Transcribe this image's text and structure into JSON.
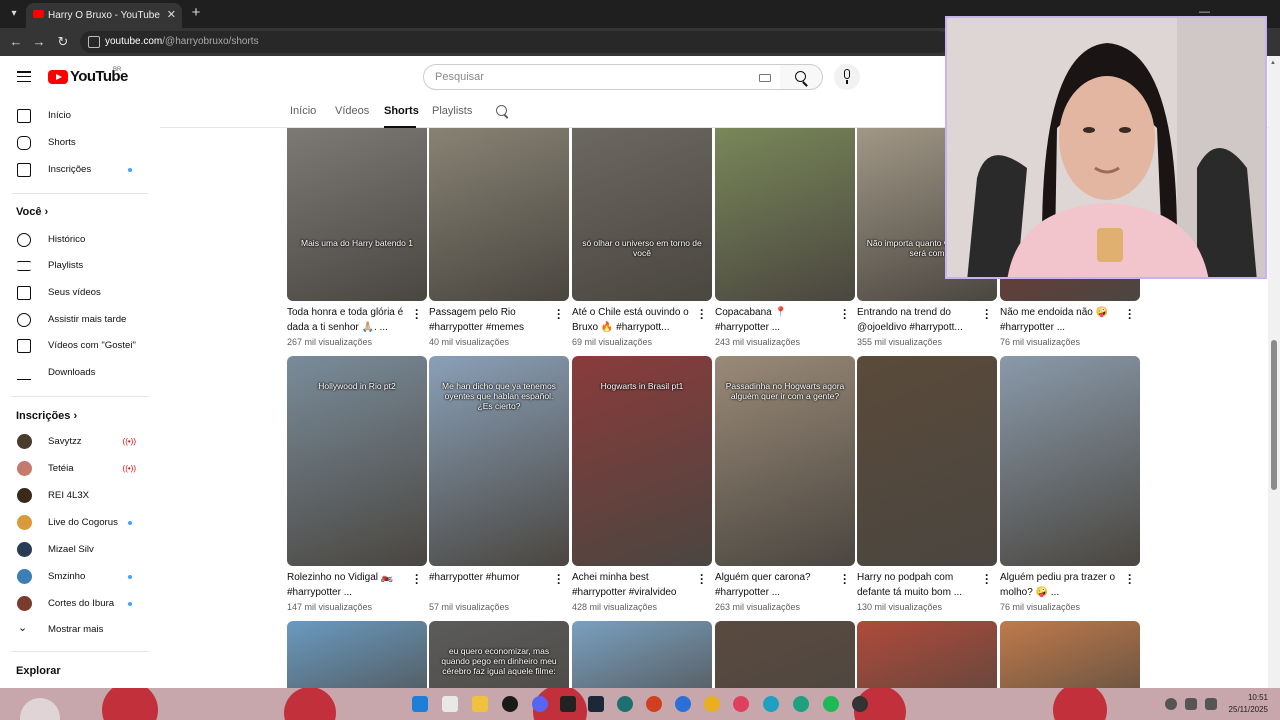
{
  "browser": {
    "tab_title": "Harry O Bruxo - YouTube",
    "url_host": "youtube.com",
    "url_path": "/@harryobruxo/shorts"
  },
  "masthead": {
    "logo_text": "YouTube",
    "country_code": "BR",
    "search_placeholder": "Pesquisar"
  },
  "sidebar": {
    "main": [
      {
        "label": "Início",
        "icon": "home-icon"
      },
      {
        "label": "Shorts",
        "icon": "shorts-icon"
      },
      {
        "label": "Inscrições",
        "icon": "subscriptions-icon",
        "dot": true
      }
    ],
    "you_heading": "Você",
    "you": [
      {
        "label": "Histórico",
        "icon": "history-icon"
      },
      {
        "label": "Playlists",
        "icon": "playlists-icon"
      },
      {
        "label": "Seus vídeos",
        "icon": "your-videos-icon"
      },
      {
        "label": "Assistir mais tarde",
        "icon": "watch-later-icon"
      },
      {
        "label": "Vídeos com \"Gostei\"",
        "icon": "like-icon"
      },
      {
        "label": "Downloads",
        "icon": "download-icon"
      }
    ],
    "subs_heading": "Inscrições",
    "subs": [
      {
        "label": "Savytzz",
        "live": true,
        "color": "#4a3b2a"
      },
      {
        "label": "Tetéia",
        "live": true,
        "color": "#c57b6b"
      },
      {
        "label": "REI 4L3X",
        "live": false,
        "color": "#3a2a1a"
      },
      {
        "label": "Live do Cogorus",
        "dot": true,
        "color": "#d89a3b"
      },
      {
        "label": "Mizael Silv",
        "live": false,
        "color": "#2b3d55"
      },
      {
        "label": "Smzinho",
        "dot": true,
        "color": "#3b7fb6"
      },
      {
        "label": "Cortes do Ibura",
        "dot": true,
        "color": "#7b3b2a"
      }
    ],
    "show_more": "Mostrar mais",
    "explore_heading": "Explorar"
  },
  "channel_tabs": [
    "Início",
    "Vídeos",
    "Shorts",
    "Playlists"
  ],
  "shorts": [
    {
      "title": "Toda honra e toda glória é dada a ti senhor 🙏🏼. ...",
      "views": "267 mil visualizações",
      "caption": "Mais uma do Harry batendo 1",
      "bg": "#7f7b78"
    },
    {
      "title": "Passagem pelo Rio #harrypotter #memes",
      "views": "40 mil visualizações",
      "caption": "",
      "bg": "#8a8576"
    },
    {
      "title": "Até o Chile está ouvindo o Bruxo 🔥 #harrypott...",
      "views": "69 mil visualizações",
      "caption": "só olhar o universo em torno de você",
      "bg": "#6d6a62"
    },
    {
      "title": "Copacabana 📍 #harrypotter ...",
      "views": "243 mil visualizações",
      "caption": "",
      "bg": "#7b8a5a"
    },
    {
      "title": "Entrando na trend do @ojoeldivo #harrypott...",
      "views": "355 mil visualizações",
      "caption": "Não importa quanto você nunca será com",
      "bg": "#a59b8a"
    },
    {
      "title": "Não me endoida não 🤪 #harrypotter ...",
      "views": "76 mil visualizações",
      "caption": "",
      "bg": "#9a2b2b"
    },
    {
      "title": "Rolezinho no Vidigal 🏍️ #harrypotter ...",
      "views": "147 mil visualizações",
      "caption": "Hollywood in Rio pt2",
      "bg": "#7a8c9a"
    },
    {
      "title": "#harrypotter #humor",
      "views": "57 mil visualizações",
      "caption": "Me han dicho que ya tenemos oyentes que hablan español. ¿Es cierto?",
      "bg": "#8aa0b8"
    },
    {
      "title": "Achei minha best #harrypotter #viralvideo",
      "views": "428 mil visualizações",
      "caption": "Hogwarts in Brasil pt1",
      "bg": "#8a3b3b"
    },
    {
      "title": "Alguém quer carona? #harrypotter ...",
      "views": "263 mil visualizações",
      "caption": "Passadinha no Hogwarts agora alguém quer ir com a gente?",
      "bg": "#9a8a78"
    },
    {
      "title": "Harry no podpah com defante tá muito bom ...",
      "views": "130 mil visualizações",
      "caption": "",
      "bg": "#5a4a3a"
    },
    {
      "title": "Alguém pediu pra trazer o molho? 🤪 ...",
      "views": "76 mil visualizações",
      "caption": "",
      "bg": "#8a9aaa"
    },
    {
      "title": "",
      "views": "",
      "caption": "",
      "bg": "#6a9ac0"
    },
    {
      "title": "",
      "views": "",
      "caption": "eu quero economizar, mas quando pego em dinheiro meu cérebro faz igual aquele filme:",
      "bg": "#5b5b5b"
    },
    {
      "title": "",
      "views": "",
      "caption": "",
      "bg": "#7aa0c0"
    },
    {
      "title": "",
      "views": "",
      "caption": "",
      "bg": "#5a4a40"
    },
    {
      "title": "",
      "views": "",
      "caption": "",
      "bg": "#b04a3a"
    },
    {
      "title": "",
      "views": "",
      "caption": "",
      "bg": "#c07a4a"
    }
  ],
  "taskbar": {
    "time": "10:51",
    "date": "25/11/2025"
  }
}
